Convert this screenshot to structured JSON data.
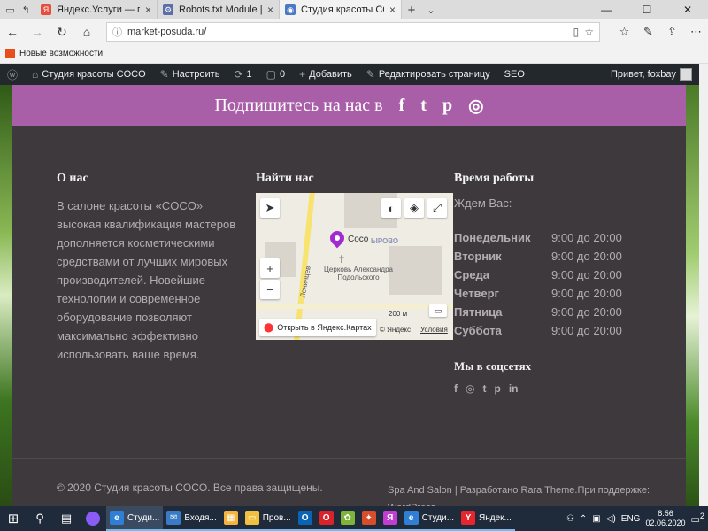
{
  "browser": {
    "tabs": [
      {
        "label": "Яндекс.Услуги — поиск усл",
        "favicon_color": "#e74c3c",
        "favicon_glyph": "Я",
        "active": false
      },
      {
        "label": "Robots.txt Module | Semper",
        "favicon_color": "#5b6ea8",
        "favicon_glyph": "⚙",
        "active": false
      },
      {
        "label": "Студия красоты COCO",
        "favicon_color": "#4a78c2",
        "favicon_glyph": "◉",
        "active": true
      }
    ],
    "window_controls": {
      "minimize": "—",
      "maximize": "☐",
      "close": "✕"
    },
    "url": "market-posuda.ru/",
    "favorites_bar": {
      "item": "Новые возможности"
    }
  },
  "wp_admin": {
    "items": [
      {
        "icon": "ⓦ",
        "label": ""
      },
      {
        "icon": "⌂",
        "label": "Студия красоты COCO"
      },
      {
        "icon": "✎",
        "label": "Настроить"
      },
      {
        "icon": "⟳",
        "label": "1"
      },
      {
        "icon": "▢",
        "label": "0"
      },
      {
        "icon": "+",
        "label": "Добавить"
      },
      {
        "icon": "✎",
        "label": "Редактировать страницу"
      },
      {
        "icon": "",
        "label": "SEO"
      }
    ],
    "greeting": "Привет, foxbay"
  },
  "social_strip": {
    "title": "Подпишитесь на нас в",
    "icons": [
      "f",
      "t",
      "p",
      "◎"
    ]
  },
  "footer": {
    "about": {
      "title": "О нас",
      "text": "В салоне красоты «COCO» высокая квалификация мастеров дополняется косметическими средствами от лучших мировых производителей. Новейшие технологии и современное оборудование позволяют максимально эффективно использовать ваше время."
    },
    "find": {
      "title": "Найти нас",
      "map": {
        "place_label": "Coco",
        "church_label": "Церковь Александра Подольского",
        "street_label": "Ленинцев",
        "district_label": "ЫРОВО",
        "scale_label": "200 м",
        "copyright_label": "© Яндекс",
        "terms_label": "Условия",
        "open_label": "Открыть в Яндекс.Картах"
      }
    },
    "hours": {
      "title": "Время работы",
      "intro": "Ждем Вас:",
      "rows": [
        {
          "day": "Понедельник",
          "time": "9:00 до 20:00"
        },
        {
          "day": "Вторник",
          "time": "9:00 до 20:00"
        },
        {
          "day": "Среда",
          "time": "9:00 до 20:00"
        },
        {
          "day": "Четверг",
          "time": "9:00 до 20:00"
        },
        {
          "day": "Пятница",
          "time": "9:00 до 20:00"
        },
        {
          "day": "Суббота",
          "time": "9:00 до 20:00"
        }
      ],
      "social_title": "Мы в соцсетях",
      "social_icons": [
        "f",
        "◎",
        "t",
        "p",
        "in"
      ]
    },
    "copyright": "© 2020 Студия красоты COCO. Все права защищены.",
    "credits": "Spa And Salon | Разработано Rara Theme.При поддержке: WordPress."
  },
  "taskbar": {
    "apps": [
      {
        "label": "Студи...",
        "color": "#2f7fd4",
        "glyph": "e",
        "active": true
      },
      {
        "label": "Входя...",
        "color": "#3a7bc8",
        "glyph": "✉",
        "active": false
      },
      {
        "label": "",
        "color": "#f3b33d",
        "glyph": "▦",
        "active": false
      },
      {
        "label": "Пров...",
        "color": "#f0c040",
        "glyph": "▭",
        "active": false
      },
      {
        "label": "",
        "color": "#0a64b5",
        "glyph": "O",
        "active": false
      },
      {
        "label": "",
        "color": "#d9222a",
        "glyph": "O",
        "active": false
      },
      {
        "label": "",
        "color": "#7fb43a",
        "glyph": "✿",
        "active": false
      },
      {
        "label": "",
        "color": "#d84e2b",
        "glyph": "✦",
        "active": false
      },
      {
        "label": "",
        "color": "#c23cd1",
        "glyph": "Я",
        "active": false
      },
      {
        "label": "Студи...",
        "color": "#2f7fd4",
        "glyph": "e",
        "active": false
      },
      {
        "label": "Яндек...",
        "color": "#e6262c",
        "glyph": "Y",
        "active": false
      }
    ],
    "language": "ENG",
    "time": "8:56",
    "date": "02.06.2020",
    "notifications": "2"
  }
}
